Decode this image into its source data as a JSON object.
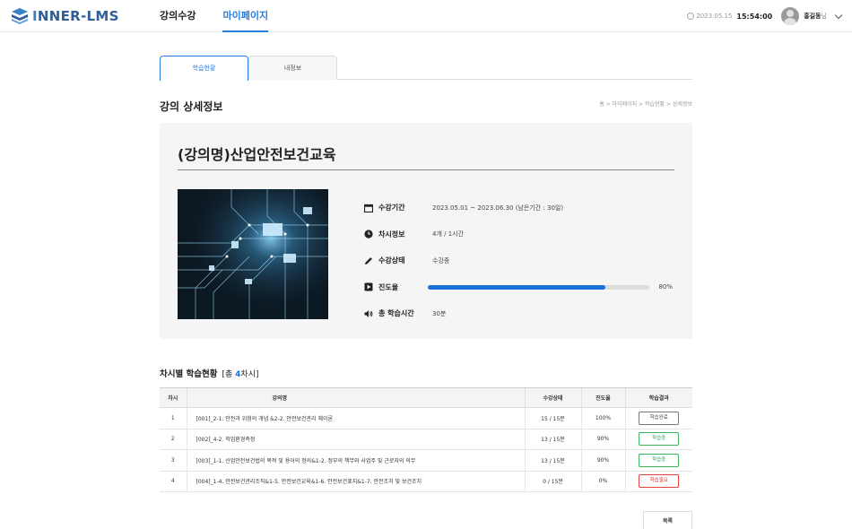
{
  "header": {
    "logo_text_a": "I",
    "logo_text_b": "NNER-LMS",
    "nav": [
      {
        "label": "강의수강"
      },
      {
        "label": "마이페이지"
      }
    ],
    "date": "2023.05.15",
    "time": "15:54:00",
    "user_name": "홍길동",
    "user_suffix": "님"
  },
  "tabs": [
    {
      "label": "학습현황"
    },
    {
      "label": "내정보"
    }
  ],
  "page": {
    "title": "강의 상세정보",
    "breadcrumb": "홈 > 마이페이지 > 학습현황 > 상세정보"
  },
  "course": {
    "title": "(강의명)산업안전보건교육",
    "period_label": "수강기간",
    "period_value": "2023.05.01 ~ 2023.06.30 (남은기간 : 30일)",
    "session_label": "차시정보",
    "session_value": "4개 / 1시간",
    "status_label": "수강상태",
    "status_value": "수강중",
    "progress_label": "진도율",
    "progress_value": 80,
    "progress_text": "80%",
    "total_time_label": "총 학습시간",
    "total_time_value": "30분"
  },
  "sessions": {
    "title": "차시별 학습현황",
    "count_prefix": "[총 ",
    "count": "4",
    "count_suffix": "차시]",
    "columns": [
      "차시",
      "강의명",
      "수강상태",
      "진도율",
      "학습결과"
    ],
    "rows": [
      {
        "no": "1",
        "name": "[001]_2-1. 안전과 위험의 개념 &2-2. 안전보건관리 체이론",
        "status": "15 / 15분",
        "progress": "100%",
        "result": "학습완료"
      },
      {
        "no": "2",
        "name": "[002]_4-2. 작업환경측정",
        "status": "13 / 15분",
        "progress": "90%",
        "result": "학습중"
      },
      {
        "no": "3",
        "name": "[003]_1-1. 산업안전보건법의 목적 및 용어의 정의&1-2. 정부의 책무와 사업주 및 근로자의 의무",
        "status": "13 / 15분",
        "progress": "90%",
        "result": "학습중"
      },
      {
        "no": "4",
        "name": "[004]_1-4. 안전보건관리조직&1-5. 안전보건교육&1-6. 안전보건표지&1-7. 안전조치 및 보건조치",
        "status": "0 / 15분",
        "progress": "0%",
        "result": "학습필요"
      }
    ]
  },
  "list_button": "목록",
  "colors": {
    "accent": "#1a73d8",
    "success": "#2ea44f",
    "danger": "#d9302a"
  }
}
